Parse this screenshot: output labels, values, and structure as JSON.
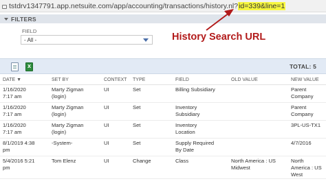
{
  "browser": {
    "url_prefix": "tstdrv1347791.app.netsuite.com/app/accounting/transactions/history.nl?",
    "url_highlight": "id=339&line=1"
  },
  "filters": {
    "title": "FILTERS",
    "field_label": "FIELD",
    "field_value": "- All -"
  },
  "annotation": {
    "text": "History Search URL",
    "color": "#b21a1a"
  },
  "toolbar": {
    "total_label": "TOTAL: 5"
  },
  "table": {
    "headers": [
      "DATE ▼",
      "SET BY",
      "CONTEXT",
      "TYPE",
      "FIELD",
      "OLD VALUE",
      "NEW VALUE"
    ],
    "rows": [
      {
        "date": "1/16/2020\n7:17 am",
        "set_by": "Marty Zigman\n(login)",
        "context": "UI",
        "type": "Set",
        "field": "Billing Subsidiary",
        "old_value": "",
        "new_value": "Parent\nCompany"
      },
      {
        "date": "1/16/2020\n7:17 am",
        "set_by": "Marty Zigman\n(login)",
        "context": "UI",
        "type": "Set",
        "field": "Inventory\nSubsidiary",
        "old_value": "",
        "new_value": "Parent\nCompany"
      },
      {
        "date": "1/16/2020\n7:17 am",
        "set_by": "Marty Zigman\n(login)",
        "context": "UI",
        "type": "Set",
        "field": "Inventory\nLocation",
        "old_value": "",
        "new_value": "3PL-US-TX1"
      },
      {
        "date": "8/1/2019 4:38\npm",
        "set_by": "-System-",
        "context": "UI",
        "type": "Set",
        "field": "Supply Required\nBy Date",
        "old_value": "",
        "new_value": "4/7/2016"
      },
      {
        "date": "5/4/2016 5:21\npm",
        "set_by": "Tom Elenz",
        "context": "UI",
        "type": "Change",
        "field": "Class",
        "old_value": "North America : US\nMidwest",
        "new_value": "North America : US\nWest"
      }
    ]
  }
}
